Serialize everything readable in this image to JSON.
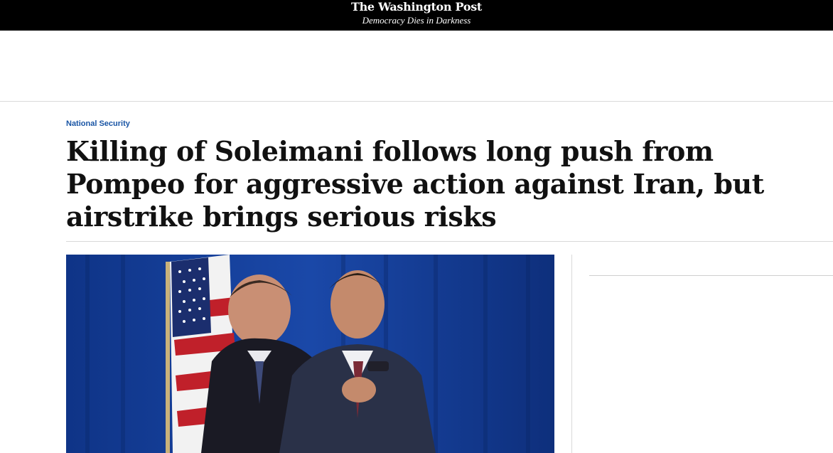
{
  "masthead": {
    "logo_text": "The Washington Post",
    "tagline": "Democracy Dies in Darkness"
  },
  "article": {
    "kicker": "National Security",
    "headline": "Killing of Soleimani follows long push from Pompeo for aggressive action against Iran, but airstrike brings serious risks"
  },
  "colors": {
    "masthead_bg": "#000000",
    "kicker": "#1955a5",
    "headline": "#111111",
    "photo_backdrop": "#123a8c"
  },
  "icons": {
    "logo": "washington-post-logo"
  }
}
